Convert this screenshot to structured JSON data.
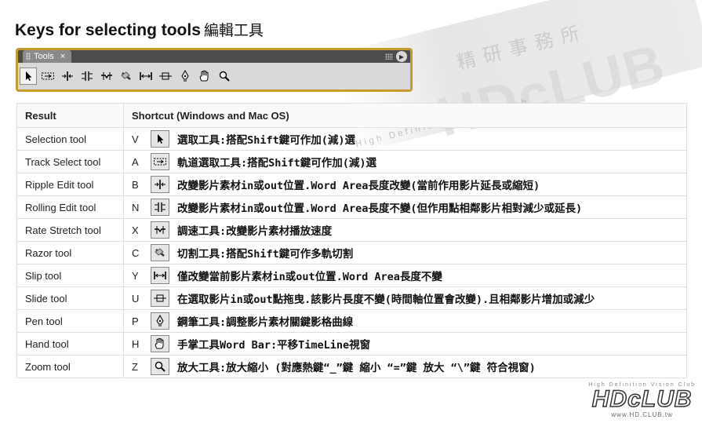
{
  "title": {
    "en": "Keys for selecting tools",
    "zh": "編輯工具"
  },
  "panel": {
    "tab_label": "Tools",
    "close_glyph": "×",
    "menu_glyph": "▶"
  },
  "toolbar": [
    {
      "icon": "selection-tool-icon",
      "active": true
    },
    {
      "icon": "track-select-tool-icon"
    },
    {
      "icon": "ripple-edit-tool-icon"
    },
    {
      "icon": "rolling-edit-tool-icon"
    },
    {
      "icon": "rate-stretch-tool-icon"
    },
    {
      "icon": "razor-tool-icon"
    },
    {
      "icon": "slip-tool-icon"
    },
    {
      "icon": "slide-tool-icon"
    },
    {
      "icon": "pen-tool-icon"
    },
    {
      "icon": "hand-tool-icon"
    },
    {
      "icon": "zoom-tool-icon"
    }
  ],
  "table": {
    "headers": {
      "result": "Result",
      "shortcut": "Shortcut (Windows and Mac OS)"
    },
    "rows": [
      {
        "result": "Selection tool",
        "key": "V",
        "icon": "selection",
        "desc": "選取工具:搭配Shift鍵可作加(減)選"
      },
      {
        "result": "Track Select tool",
        "key": "A",
        "icon": "track-select",
        "desc": "軌道選取工具:搭配Shift鍵可作加(減)選"
      },
      {
        "result": "Ripple Edit tool",
        "key": "B",
        "icon": "ripple",
        "desc": "改變影片素材in或out位置.Word Area長度改變(當前作用影片延長或縮短)"
      },
      {
        "result": "Rolling Edit tool",
        "key": "N",
        "icon": "rolling",
        "desc": "改變影片素材in或out位置.Word Area長度不變(但作用點相鄰影片相對減少或延長)"
      },
      {
        "result": "Rate Stretch tool",
        "key": "X",
        "icon": "rate",
        "desc": "調速工具:改變影片素材播放速度"
      },
      {
        "result": "Razor tool",
        "key": "C",
        "icon": "razor",
        "desc": "切割工具:搭配Shift鍵可作多軌切割"
      },
      {
        "result": "Slip tool",
        "key": "Y",
        "icon": "slip",
        "desc": "僅改變當前影片素材in或out位置.Word Area長度不變"
      },
      {
        "result": "Slide tool",
        "key": "U",
        "icon": "slide",
        "desc": "在選取影片in或out點拖曳.該影片長度不變(時間軸位置會改變).且相鄰影片增加或減少"
      },
      {
        "result": "Pen tool",
        "key": "P",
        "icon": "pen",
        "desc": "鋼筆工具:調整影片素材關鍵影格曲線"
      },
      {
        "result": "Hand tool",
        "key": "H",
        "icon": "hand",
        "desc": "手掌工具Word Bar:平移TimeLine視窗"
      },
      {
        "result": "Zoom tool",
        "key": "Z",
        "icon": "zoom",
        "desc": "放大工具:放大縮小 (對應熱鍵“_”鍵 縮小 “=”鍵 放大 “\\”鍵 符合視窗)"
      }
    ]
  },
  "watermark": {
    "logo": "HDcLUB",
    "zh": "精研事務所",
    "sub": "High Definition Vision Club",
    "corner_small": "High Definition Vision Club",
    "corner_big": "HDcLUB",
    "corner_url": "www.HD.CLUB.tw"
  }
}
